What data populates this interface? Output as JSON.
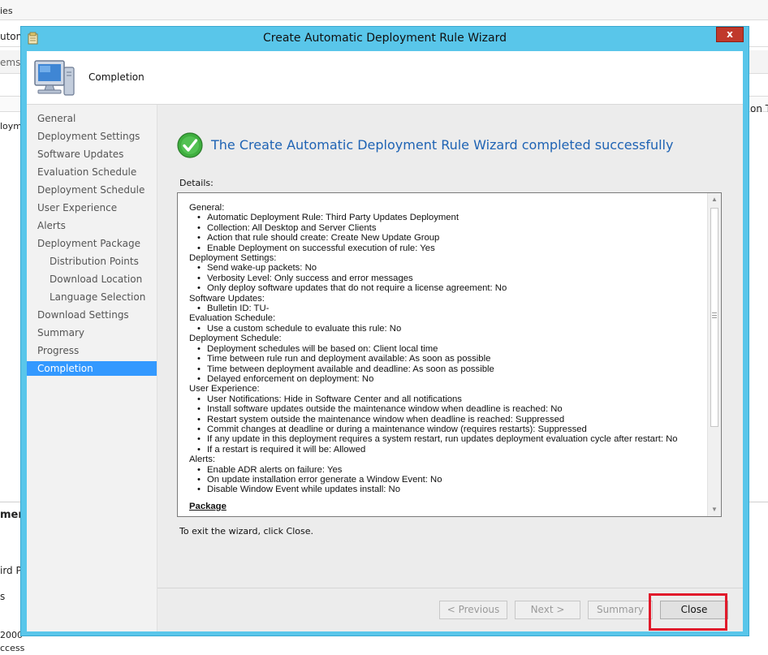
{
  "background_app": {
    "fragments": [
      "ies",
      "utom",
      "ems",
      "on T",
      "loym",
      "men",
      "ird P",
      "s",
      "2000",
      "ccess"
    ]
  },
  "dialog": {
    "title": "Create Automatic Deployment Rule Wizard",
    "close_glyph": "x",
    "header_title": "Completion"
  },
  "nav": {
    "items": [
      {
        "label": "General"
      },
      {
        "label": "Deployment Settings"
      },
      {
        "label": "Software Updates"
      },
      {
        "label": "Evaluation Schedule"
      },
      {
        "label": "Deployment Schedule"
      },
      {
        "label": "User Experience"
      },
      {
        "label": "Alerts"
      },
      {
        "label": "Deployment Package"
      },
      {
        "label": "Distribution Points"
      },
      {
        "label": "Download Location"
      },
      {
        "label": "Language Selection"
      },
      {
        "label": "Download Settings"
      },
      {
        "label": "Summary"
      },
      {
        "label": "Progress"
      },
      {
        "label": "Completion"
      }
    ],
    "selected": "Completion"
  },
  "content": {
    "success_message": "The Create Automatic Deployment Rule Wizard completed successfully",
    "details_label": "Details:",
    "details": [
      {
        "heading": "General:",
        "bullets": [
          "Automatic Deployment Rule: Third Party Updates Deployment",
          "Collection: All Desktop and Server Clients",
          "Action that rule should create: Create New Update Group",
          "Enable Deployment on successful execution of rule: Yes"
        ]
      },
      {
        "heading": "Deployment Settings:",
        "bullets": [
          "Send wake-up packets: No",
          "Verbosity Level: Only success and error messages",
          "Only deploy software updates that do not require a license agreement: No"
        ]
      },
      {
        "heading": "Software Updates:",
        "bullets": [
          "Bulletin ID: TU-"
        ]
      },
      {
        "heading": "Evaluation Schedule:",
        "bullets": [
          "Use a custom schedule to evaluate this rule: No"
        ]
      },
      {
        "heading": "Deployment Schedule:",
        "bullets": [
          "Deployment schedules will be based on: Client local time",
          "Time between rule run and deployment available: As soon as possible",
          "Time between deployment available and deadline: As soon as possible",
          "Delayed enforcement on deployment: No"
        ]
      },
      {
        "heading": "User Experience:",
        "bullets": [
          "User Notifications: Hide in Software Center and all notifications",
          "Install software updates outside the maintenance window when deadline is reached: No",
          "Restart system outside the maintenance window when deadline is reached: Suppressed",
          "Commit changes at deadline or during a maintenance window (requires restarts): Suppressed",
          "If any update in this deployment requires a system restart, run updates deployment evaluation cycle after restart: No",
          "If a restart is required it will be: Allowed"
        ]
      },
      {
        "heading": "Alerts:",
        "bullets": [
          "Enable ADR alerts on failure: Yes",
          "On update installation error generate a Window Event: No",
          "Disable Window Event while updates install: No"
        ]
      }
    ],
    "package_heading": "Package",
    "exit_text": "To exit the wizard, click Close."
  },
  "buttons": {
    "previous": "< Previous",
    "next": "Next >",
    "summary": "Summary",
    "close": "Close"
  },
  "colors": {
    "title_bar": "#59c6ea",
    "nav_selected": "#3399ff",
    "success_text": "#1e63b4",
    "highlight_box": "#e11a2b"
  }
}
